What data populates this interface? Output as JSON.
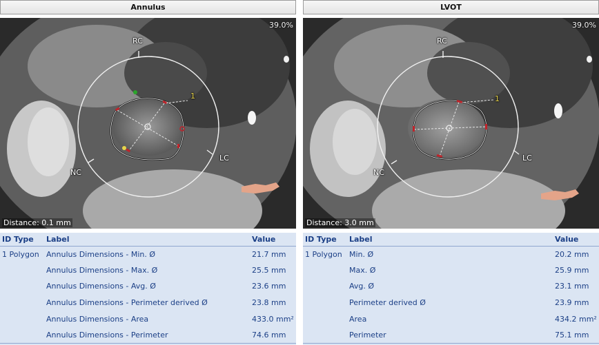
{
  "columns": {
    "id_type": "ID Type",
    "label": "Label",
    "value": "Value"
  },
  "left": {
    "title": "Annulus",
    "zoom": "39.0%",
    "distance": "Distance: 0.1 mm",
    "orientation": {
      "top": "RC",
      "right": "LC",
      "left": "NC"
    },
    "point_label": "1",
    "row_id": "1",
    "row_type": "Polygon",
    "rows": [
      {
        "label": "Annulus Dimensions - Min. Ø",
        "value": "21.7 mm"
      },
      {
        "label": "Annulus Dimensions - Max. Ø",
        "value": "25.5 mm"
      },
      {
        "label": "Annulus Dimensions - Avg. Ø",
        "value": "23.6 mm"
      },
      {
        "label": "Annulus Dimensions - Perimeter derived Ø",
        "value": "23.8 mm"
      },
      {
        "label": "Annulus Dimensions - Area",
        "value": "433.0 mm²"
      },
      {
        "label": "Annulus Dimensions - Perimeter",
        "value": "74.6 mm"
      }
    ]
  },
  "right": {
    "title": "LVOT",
    "zoom": "39.0%",
    "distance": "Distance: 3.0 mm",
    "orientation": {
      "top": "RC",
      "right": "LC",
      "left": "NC"
    },
    "point_label": "1",
    "row_id": "1",
    "row_type": "Polygon",
    "rows": [
      {
        "label": "Min. Ø",
        "value": "20.2 mm"
      },
      {
        "label": "Max. Ø",
        "value": "25.9 mm"
      },
      {
        "label": "Avg. Ø",
        "value": "23.1 mm"
      },
      {
        "label": "Perimeter derived Ø",
        "value": "23.9 mm"
      },
      {
        "label": "Area",
        "value": "434.2 mm²"
      },
      {
        "label": "Perimeter",
        "value": "75.1 mm"
      }
    ]
  },
  "colors": {
    "header_text": "#1b3f86",
    "table_bg": "#dbe5f3",
    "contour_marker": "#c0232a",
    "point_label": "#e8d44a"
  }
}
